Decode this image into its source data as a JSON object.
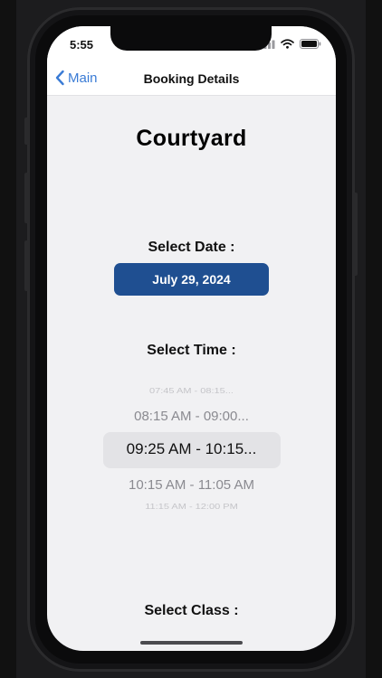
{
  "status_bar": {
    "time": "5:55"
  },
  "nav": {
    "back_label": "Main",
    "title": "Booking Details"
  },
  "venue": {
    "name": "Courtyard"
  },
  "date_section": {
    "label": "Select Date :",
    "selected_date": "July 29, 2024"
  },
  "time_section": {
    "label": "Select Time :",
    "options": [
      "07:45 AM - 08:15...",
      "08:15 AM - 09:00...",
      "09:25 AM - 10:15...",
      "10:15 AM - 11:05 AM",
      "11:15 AM - 12:00 PM"
    ],
    "selected_index": 2
  },
  "class_section": {
    "label": "Select Class :"
  },
  "colors": {
    "accent": "#1f4f91",
    "link": "#3a7bd5",
    "background": "#f1f1f3"
  }
}
